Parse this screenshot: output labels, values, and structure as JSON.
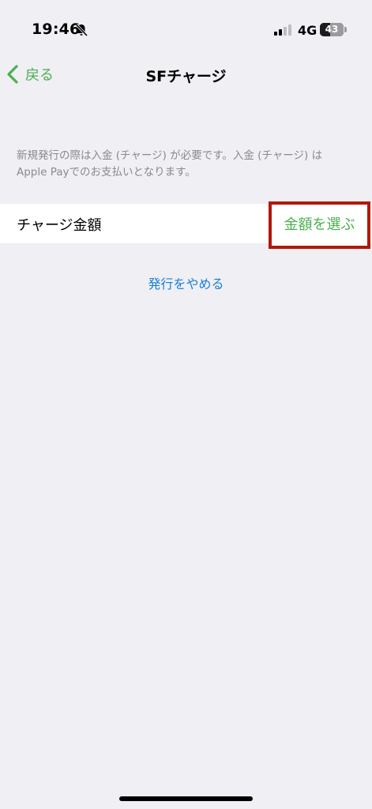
{
  "status_bar": {
    "time": "19:46",
    "network": "4G",
    "battery_level": "43",
    "battery_percent": 43
  },
  "nav": {
    "back_label": "戻る",
    "title": "SFチャージ"
  },
  "notice": {
    "text": "新規発行の際は入金 (チャージ) が必要です。入金 (チャージ) は Apple Payでのお支払いとなります。"
  },
  "charge_row": {
    "label": "チャージ金額",
    "action_label": "金額を選ぶ"
  },
  "cancel": {
    "label": "発行をやめる"
  },
  "colors": {
    "accent_green": "#4caf50",
    "link_blue": "#1a7fd4",
    "highlight_red": "#b3170a",
    "background": "#efeff4"
  }
}
